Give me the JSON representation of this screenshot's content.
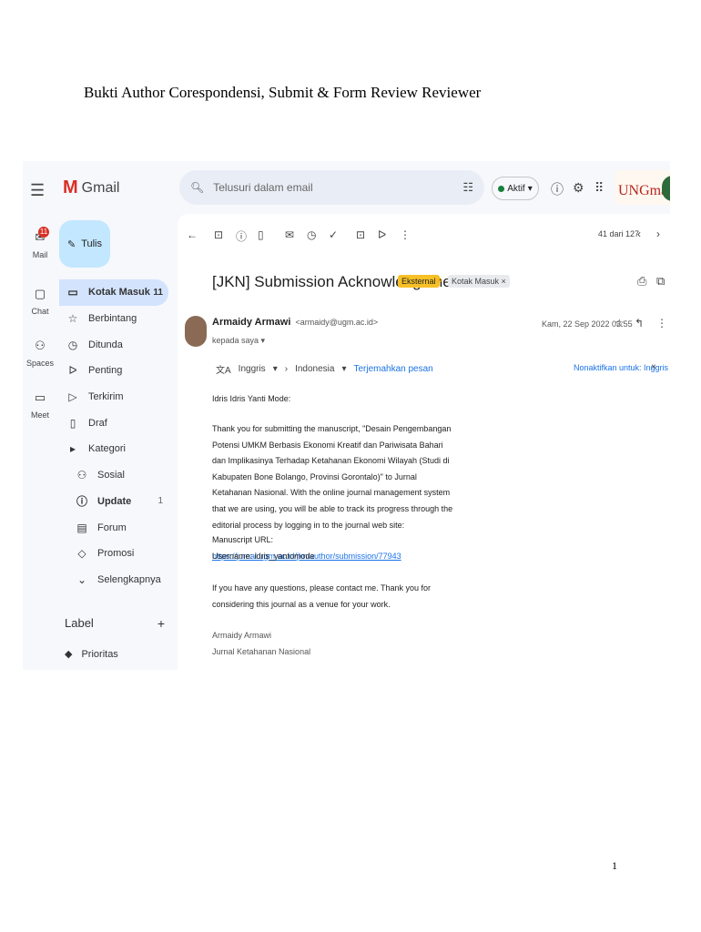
{
  "doc": {
    "title": "Bukti Author Corespondensi, Submit & Form Review Reviewer",
    "page_number": "1"
  },
  "gmail": {
    "app_name": "Gmail",
    "rail": {
      "mail_label": "Mail",
      "mail_badge": "11",
      "chat_label": "Chat",
      "spaces_label": "Spaces",
      "meet_label": "Meet"
    },
    "search": {
      "placeholder": "Telusuri dalam email"
    },
    "status": {
      "label": "Aktif"
    },
    "brand": {
      "text": "UNGmail"
    },
    "compose": {
      "label": "Tulis"
    },
    "nav": [
      {
        "icon": "inbox-icon",
        "glyph": "▭",
        "label": "Kotak Masuk",
        "count": "11"
      },
      {
        "icon": "star-icon",
        "glyph": "☆",
        "label": "Berbintang",
        "count": ""
      },
      {
        "icon": "clock-icon",
        "glyph": "◷",
        "label": "Ditunda",
        "count": ""
      },
      {
        "icon": "important-icon",
        "glyph": "ᐅ",
        "label": "Penting",
        "count": ""
      },
      {
        "icon": "send-icon",
        "glyph": "▷",
        "label": "Terkirim",
        "count": ""
      },
      {
        "icon": "draft-icon",
        "glyph": "▯",
        "label": "Draf",
        "count": ""
      },
      {
        "icon": "category-icon",
        "glyph": "▸",
        "label": "Kategori",
        "count": ""
      },
      {
        "icon": "social-icon",
        "glyph": "⚇",
        "label": "Sosial",
        "count": ""
      },
      {
        "icon": "info-icon",
        "glyph": "ⓘ",
        "label": "Update",
        "count": "1"
      },
      {
        "icon": "forum-icon",
        "glyph": "▤",
        "label": "Forum",
        "count": ""
      },
      {
        "icon": "tag-icon",
        "glyph": "◇",
        "label": "Promosi",
        "count": ""
      },
      {
        "icon": "chevron-down-icon",
        "glyph": "⌄",
        "label": "Selengkapnya",
        "count": ""
      }
    ],
    "labels": {
      "heading": "Label",
      "items": [
        {
          "label": "Prioritas"
        }
      ]
    },
    "pager": {
      "text": "41 dari 127"
    },
    "message": {
      "subject": "[JKN] Submission Acknowledgement",
      "chip_external": "Eksternal",
      "chip_inbox": "Kotak Masuk ×",
      "sender_name": "Armaidy Armawi",
      "sender_email": "<armaidy@ugm.ac.id>",
      "to": "kepada saya ▾",
      "date": "Kam, 22 Sep 2022 03.55",
      "translate": {
        "from": "Inggris",
        "to": "Indonesia",
        "action": "Terjemahkan pesan",
        "off": "Nonaktifkan untuk: Inggris"
      },
      "greeting": "Idris Idris Yanti Mode:",
      "para1": "Thank you for submitting the manuscript, \"Desain Pengembangan Potensi UMKM Berbasis Ekonomi Kreatif dan Pariwisata Bahari dan Implikasinya Terhadap Ketahanan Ekonomi Wilayah (Studi di Kabupaten Bone Bolango, Provinsi Gorontalo)\" to Jurnal Ketahanan Nasional. With the online journal management system that we are using, you will be able to track its progress through the editorial process by logging in to the journal web site:",
      "url_label": "Manuscript URL:",
      "url": "https://jurnal.ugm.ac.id/jkn/author/submission/77943",
      "username": "Username: idris_yantomode",
      "para2": "If you have any questions, please contact me. Thank you for considering this journal as a venue for your work.",
      "sig_name": "Armaidy Armawi",
      "sig_journal": "Jurnal Ketahanan Nasional"
    }
  }
}
